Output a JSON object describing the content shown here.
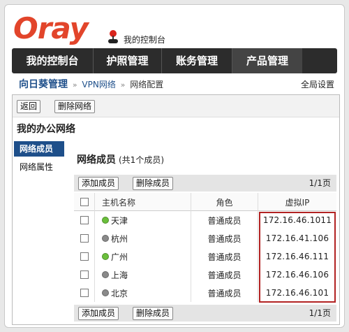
{
  "header": {
    "logo_text": "Oray",
    "console_title": "我的控制台"
  },
  "nav": {
    "tabs": [
      {
        "label": "我的控制台"
      },
      {
        "label": "护照管理"
      },
      {
        "label": "账务管理"
      },
      {
        "label": "产品管理",
        "active": true
      }
    ]
  },
  "breadcrumb": {
    "root": "向日葵管理",
    "sep": "»",
    "level1": "VPN网络",
    "level2": "网络配置"
  },
  "global_settings": "全局设置",
  "toolbar": {
    "back": "返回",
    "delete_network": "删除网络"
  },
  "network_title": "我的办公网络",
  "sidebar": {
    "items": [
      {
        "label": "网络成员",
        "active": true
      },
      {
        "label": "网络属性",
        "active": false
      }
    ]
  },
  "panel": {
    "title": "网络成员",
    "count": "(共1个成员)",
    "add_button": "添加成员",
    "delete_button": "删除成员",
    "pager": "1/1页"
  },
  "table": {
    "headers": {
      "host": "主机名称",
      "role": "角色",
      "ip": "虚拟IP"
    },
    "rows": [
      {
        "host": "天津",
        "status": "online",
        "role": "普通成员",
        "ip": "172.16.46.1011"
      },
      {
        "host": "杭州",
        "status": "offline",
        "role": "普通成员",
        "ip": "172.16.41.106"
      },
      {
        "host": "广州",
        "status": "online",
        "role": "普通成员",
        "ip": "172.16.46.111"
      },
      {
        "host": "上海",
        "status": "offline",
        "role": "普通成员",
        "ip": "172.16.46.106"
      },
      {
        "host": "北京",
        "status": "offline",
        "role": "普通成员",
        "ip": "172.16.46.101"
      }
    ]
  },
  "colors": {
    "online": "#6abf3b",
    "offline": "#8a8a8a",
    "brand": "#e2452b",
    "link": "#1e4f8a",
    "highlight": "#b22222"
  }
}
